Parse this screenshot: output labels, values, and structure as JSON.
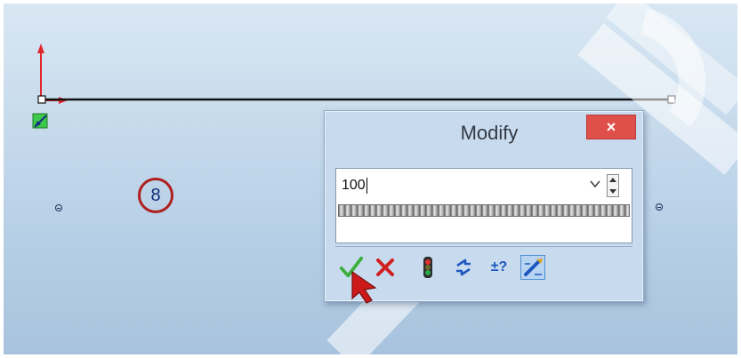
{
  "dialog": {
    "title": "Modify",
    "close_label": "×",
    "value": "100"
  },
  "annotation": {
    "step_number": "8"
  },
  "toolbar": {
    "buttons": [
      {
        "name": "ok-button",
        "icon": "checkmark-icon"
      },
      {
        "name": "cancel-button",
        "icon": "red-x-icon"
      },
      {
        "name": "rebuild-button",
        "icon": "traffic-light-icon"
      },
      {
        "name": "reverse-direction-button",
        "icon": "reverse-arrow-icon"
      },
      {
        "name": "mark-for-drawing-button",
        "icon": "plus-minus-question-icon"
      },
      {
        "name": "tolerance-button",
        "icon": "pencil-dimension-icon"
      }
    ]
  },
  "colors": {
    "accent_red": "#e0504a",
    "annotation_circle": "#b01e1e",
    "ok_green": "#3cae3c",
    "cursor_red": "#cc1a1a",
    "sketch_line": "#111111"
  }
}
